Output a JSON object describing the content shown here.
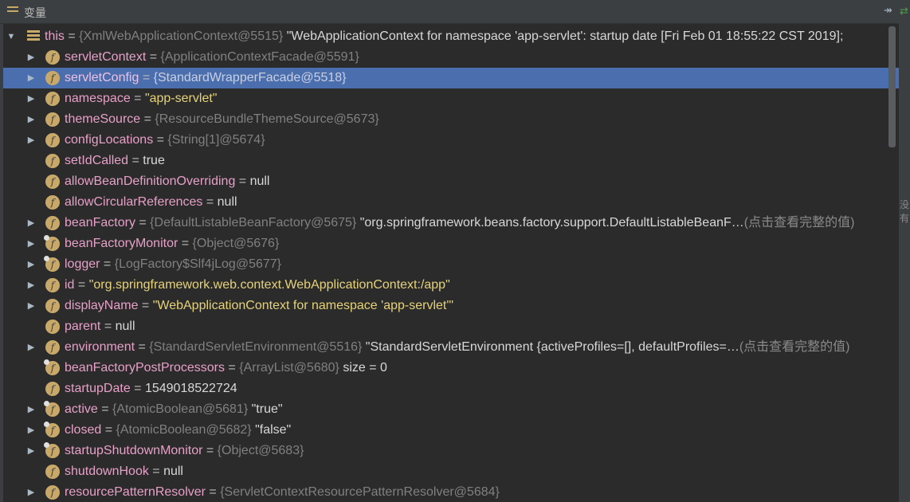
{
  "panel": {
    "title": "变量",
    "pin_glyph": "↠",
    "side_glyph": "⇄",
    "side_text": "没有"
  },
  "root": {
    "name": "this",
    "eq": " = ",
    "ref": "{XmlWebApplicationContext@5515}",
    "value": " \"WebApplicationContext for namespace 'app-servlet': startup date [Fri Feb 01 18:55:22 CST 2019];"
  },
  "rows": [
    {
      "name": "servletContext",
      "eq": " = ",
      "ref": "{ApplicationContextFacade@5591}",
      "str": "",
      "val": "",
      "hint": ""
    },
    {
      "name": "servletConfig",
      "eq": " = ",
      "ref": "{StandardWrapperFacade@5518}",
      "str": "",
      "val": "",
      "hint": ""
    },
    {
      "name": "namespace",
      "eq": " = ",
      "ref": "",
      "str": "\"app-servlet\"",
      "val": "",
      "hint": ""
    },
    {
      "name": "themeSource",
      "eq": " = ",
      "ref": "{ResourceBundleThemeSource@5673}",
      "str": "",
      "val": "",
      "hint": ""
    },
    {
      "name": "configLocations",
      "eq": " = ",
      "ref": "{String[1]@5674}",
      "str": "",
      "val": "",
      "hint": ""
    },
    {
      "name": "setIdCalled",
      "eq": " = ",
      "ref": "",
      "str": "",
      "val": "true",
      "hint": ""
    },
    {
      "name": "allowBeanDefinitionOverriding",
      "eq": " = ",
      "ref": "",
      "str": "",
      "val": "null",
      "hint": ""
    },
    {
      "name": "allowCircularReferences",
      "eq": " = ",
      "ref": "",
      "str": "",
      "val": "null",
      "hint": ""
    },
    {
      "name": "beanFactory",
      "eq": " = ",
      "ref": "{DefaultListableBeanFactory@5675}",
      "str": "",
      "val": " \"org.springframework.beans.factory.support.DefaultListableBeanF…",
      "hint": "(点击查看完整的值)"
    },
    {
      "name": "beanFactoryMonitor",
      "eq": " = ",
      "ref": "{Object@5676}",
      "str": "",
      "val": "",
      "hint": ""
    },
    {
      "name": "logger",
      "eq": " = ",
      "ref": "{LogFactory$Slf4jLog@5677}",
      "str": "",
      "val": "",
      "hint": ""
    },
    {
      "name": "id",
      "eq": " = ",
      "ref": "",
      "str": "\"org.springframework.web.context.WebApplicationContext:/app\"",
      "val": "",
      "hint": ""
    },
    {
      "name": "displayName",
      "eq": " = ",
      "ref": "",
      "str": "\"WebApplicationContext for namespace 'app-servlet'\"",
      "val": "",
      "hint": ""
    },
    {
      "name": "parent",
      "eq": " = ",
      "ref": "",
      "str": "",
      "val": "null",
      "hint": ""
    },
    {
      "name": "environment",
      "eq": " = ",
      "ref": "{StandardServletEnvironment@5516}",
      "str": "",
      "val": " \"StandardServletEnvironment {activeProfiles=[], defaultProfiles=…",
      "hint": "(点击查看完整的值)"
    },
    {
      "name": "beanFactoryPostProcessors",
      "eq": " = ",
      "ref": "{ArrayList@5680}",
      "str": "",
      "val": "  size = 0",
      "hint": ""
    },
    {
      "name": "startupDate",
      "eq": " = ",
      "ref": "",
      "str": "",
      "val": "1549018522724",
      "hint": ""
    },
    {
      "name": "active",
      "eq": " = ",
      "ref": "{AtomicBoolean@5681}",
      "str": "",
      "val": " \"true\"",
      "hint": ""
    },
    {
      "name": "closed",
      "eq": " = ",
      "ref": "{AtomicBoolean@5682}",
      "str": "",
      "val": " \"false\"",
      "hint": ""
    },
    {
      "name": "startupShutdownMonitor",
      "eq": " = ",
      "ref": "{Object@5683}",
      "str": "",
      "val": "",
      "hint": ""
    },
    {
      "name": "shutdownHook",
      "eq": " = ",
      "ref": "",
      "str": "",
      "val": "null",
      "hint": ""
    },
    {
      "name": "resourcePatternResolver",
      "eq": " = ",
      "ref": "{ServletContextResourcePatternResolver@5684}",
      "str": "",
      "val": "",
      "hint": ""
    }
  ],
  "icons": {
    "expand": "triangle-right-icon",
    "collapse": "triangle-down-icon",
    "field": "field-f-icon"
  },
  "colors": {
    "selection": "#4b6eaf",
    "field_name": "#e8a0c8",
    "string": "#e6d27a",
    "reference": "#808080"
  }
}
